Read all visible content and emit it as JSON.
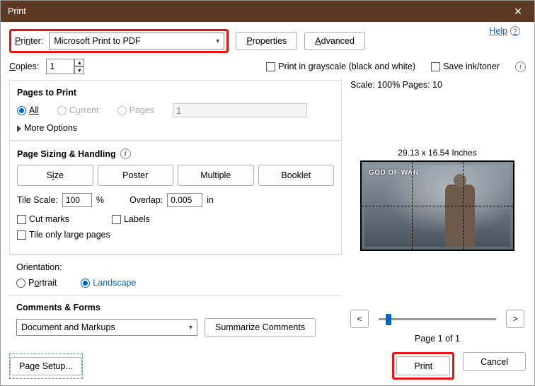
{
  "window": {
    "title": "Print",
    "close": "✕"
  },
  "help": {
    "label": "Help"
  },
  "printer": {
    "label": "Printer:",
    "selected": "Microsoft Print to PDF",
    "properties": "Properties",
    "advanced": "Advanced"
  },
  "copies": {
    "label": "Copies:",
    "value": "1",
    "grayscale": "Print in grayscale (black and white)",
    "saveink": "Save ink/toner"
  },
  "pages_to_print": {
    "title": "Pages to Print",
    "all": "All",
    "current": "Current",
    "pages": "Pages",
    "range": "1",
    "more": "More Options"
  },
  "sizing": {
    "title": "Page Sizing & Handling",
    "size": "Size",
    "poster": "Poster",
    "multiple": "Multiple",
    "booklet": "Booklet",
    "tile_scale_label": "Tile Scale:",
    "tile_scale": "100",
    "tile_scale_unit": "%",
    "overlap_label": "Overlap:",
    "overlap": "0.005",
    "overlap_unit": "in",
    "cutmarks": "Cut marks",
    "labels": "Labels",
    "tilelarge": "Tile only large pages"
  },
  "orientation": {
    "title": "Orientation:",
    "portrait": "Portrait",
    "landscape": "Landscape"
  },
  "comments": {
    "title": "Comments & Forms",
    "selected": "Document and Markups",
    "summarize": "Summarize Comments"
  },
  "preview": {
    "scale_label": "Scale: 100% Pages: 10",
    "dims": "29.13 x 16.54 Inches",
    "logo": "GOD OF WAR",
    "prev": "<",
    "next": ">",
    "page": "Page 1 of 1"
  },
  "footer": {
    "pagesetup": "Page Setup...",
    "print": "Print",
    "cancel": "Cancel"
  }
}
